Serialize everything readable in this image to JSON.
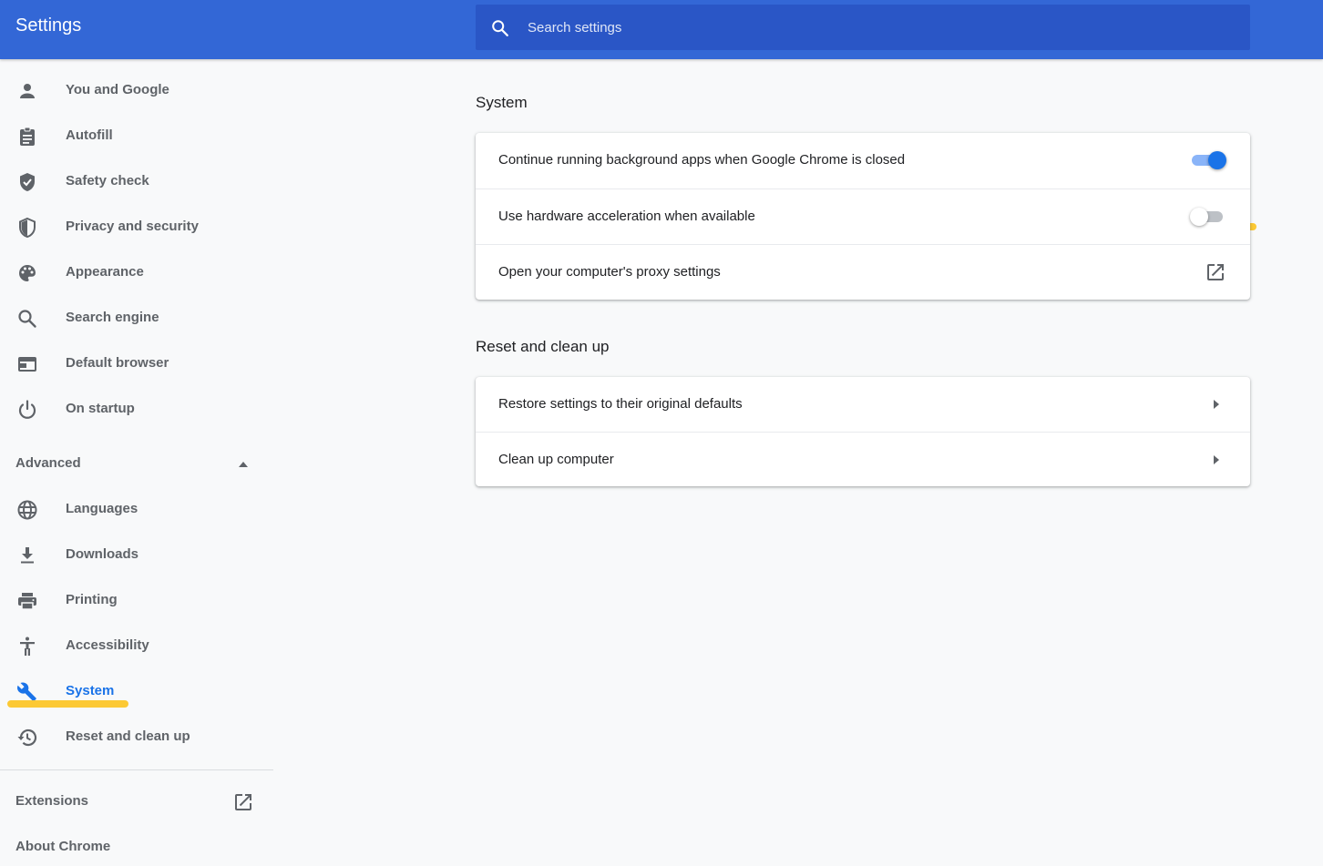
{
  "header": {
    "title": "Settings",
    "search_placeholder": "Search settings",
    "search_icon": "search-icon"
  },
  "sidebar": {
    "items": [
      {
        "label": "You and Google",
        "icon": "person-icon"
      },
      {
        "label": "Autofill",
        "icon": "clipboard-icon"
      },
      {
        "label": "Safety check",
        "icon": "shield-check-icon"
      },
      {
        "label": "Privacy and security",
        "icon": "shield-icon"
      },
      {
        "label": "Appearance",
        "icon": "palette-icon"
      },
      {
        "label": "Search engine",
        "icon": "search-icon"
      },
      {
        "label": "Default browser",
        "icon": "browser-window-icon"
      },
      {
        "label": "On startup",
        "icon": "power-icon"
      }
    ],
    "advanced": {
      "label": "Advanced",
      "expanded": true,
      "icon": "caret-up-icon"
    },
    "advanced_items": [
      {
        "label": "Languages",
        "icon": "globe-icon"
      },
      {
        "label": "Downloads",
        "icon": "download-icon"
      },
      {
        "label": "Printing",
        "icon": "printer-icon"
      },
      {
        "label": "Accessibility",
        "icon": "accessibility-icon"
      },
      {
        "label": "System",
        "icon": "wrench-icon",
        "active": true
      },
      {
        "label": "Reset and clean up",
        "icon": "history-icon"
      }
    ],
    "extensions": {
      "label": "Extensions",
      "icon": "external-link-icon"
    },
    "about": {
      "label": "About Chrome"
    }
  },
  "main": {
    "system": {
      "title": "System",
      "rows": [
        {
          "label": "Continue running background apps when Google Chrome is closed",
          "control": "toggle",
          "checked": true
        },
        {
          "label": "Use hardware acceleration when available",
          "control": "toggle",
          "checked": false
        },
        {
          "label": "Open your computer's proxy settings",
          "control": "external-link-icon"
        }
      ]
    },
    "reset": {
      "title": "Reset and clean up",
      "rows": [
        {
          "label": "Restore settings to their original defaults",
          "control": "chevron-right-icon"
        },
        {
          "label": "Clean up computer",
          "control": "chevron-right-icon"
        }
      ]
    }
  },
  "colors": {
    "header_bg": "#3367d6",
    "accent": "#1a73e8",
    "highlight": "#fcc934"
  }
}
